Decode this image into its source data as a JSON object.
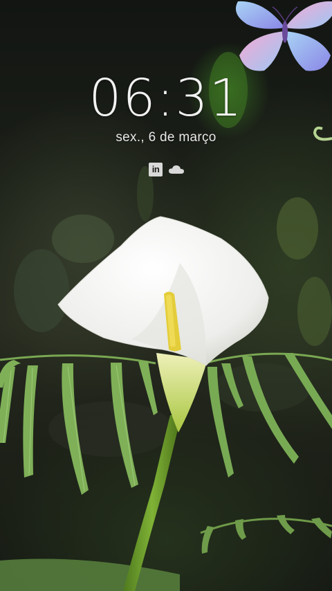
{
  "lockscreen": {
    "time": "06:31",
    "date": "sex., 6 de março"
  },
  "notifications": {
    "icons": [
      {
        "name": "linkedin-icon",
        "glyph": "in"
      },
      {
        "name": "cloud-icon"
      }
    ]
  },
  "wallpaper": {
    "subject": "calla-lily-butterfly-live-wallpaper",
    "colors": {
      "background": "#1b1f18",
      "petal": "#f4f4f2",
      "spadix": "#e6cf3a",
      "stem": "#6b9a2a",
      "fern": "#7fae5a",
      "butterfly_blue": "#8fb8f0",
      "butterfly_pink": "#f0a8d8"
    }
  }
}
